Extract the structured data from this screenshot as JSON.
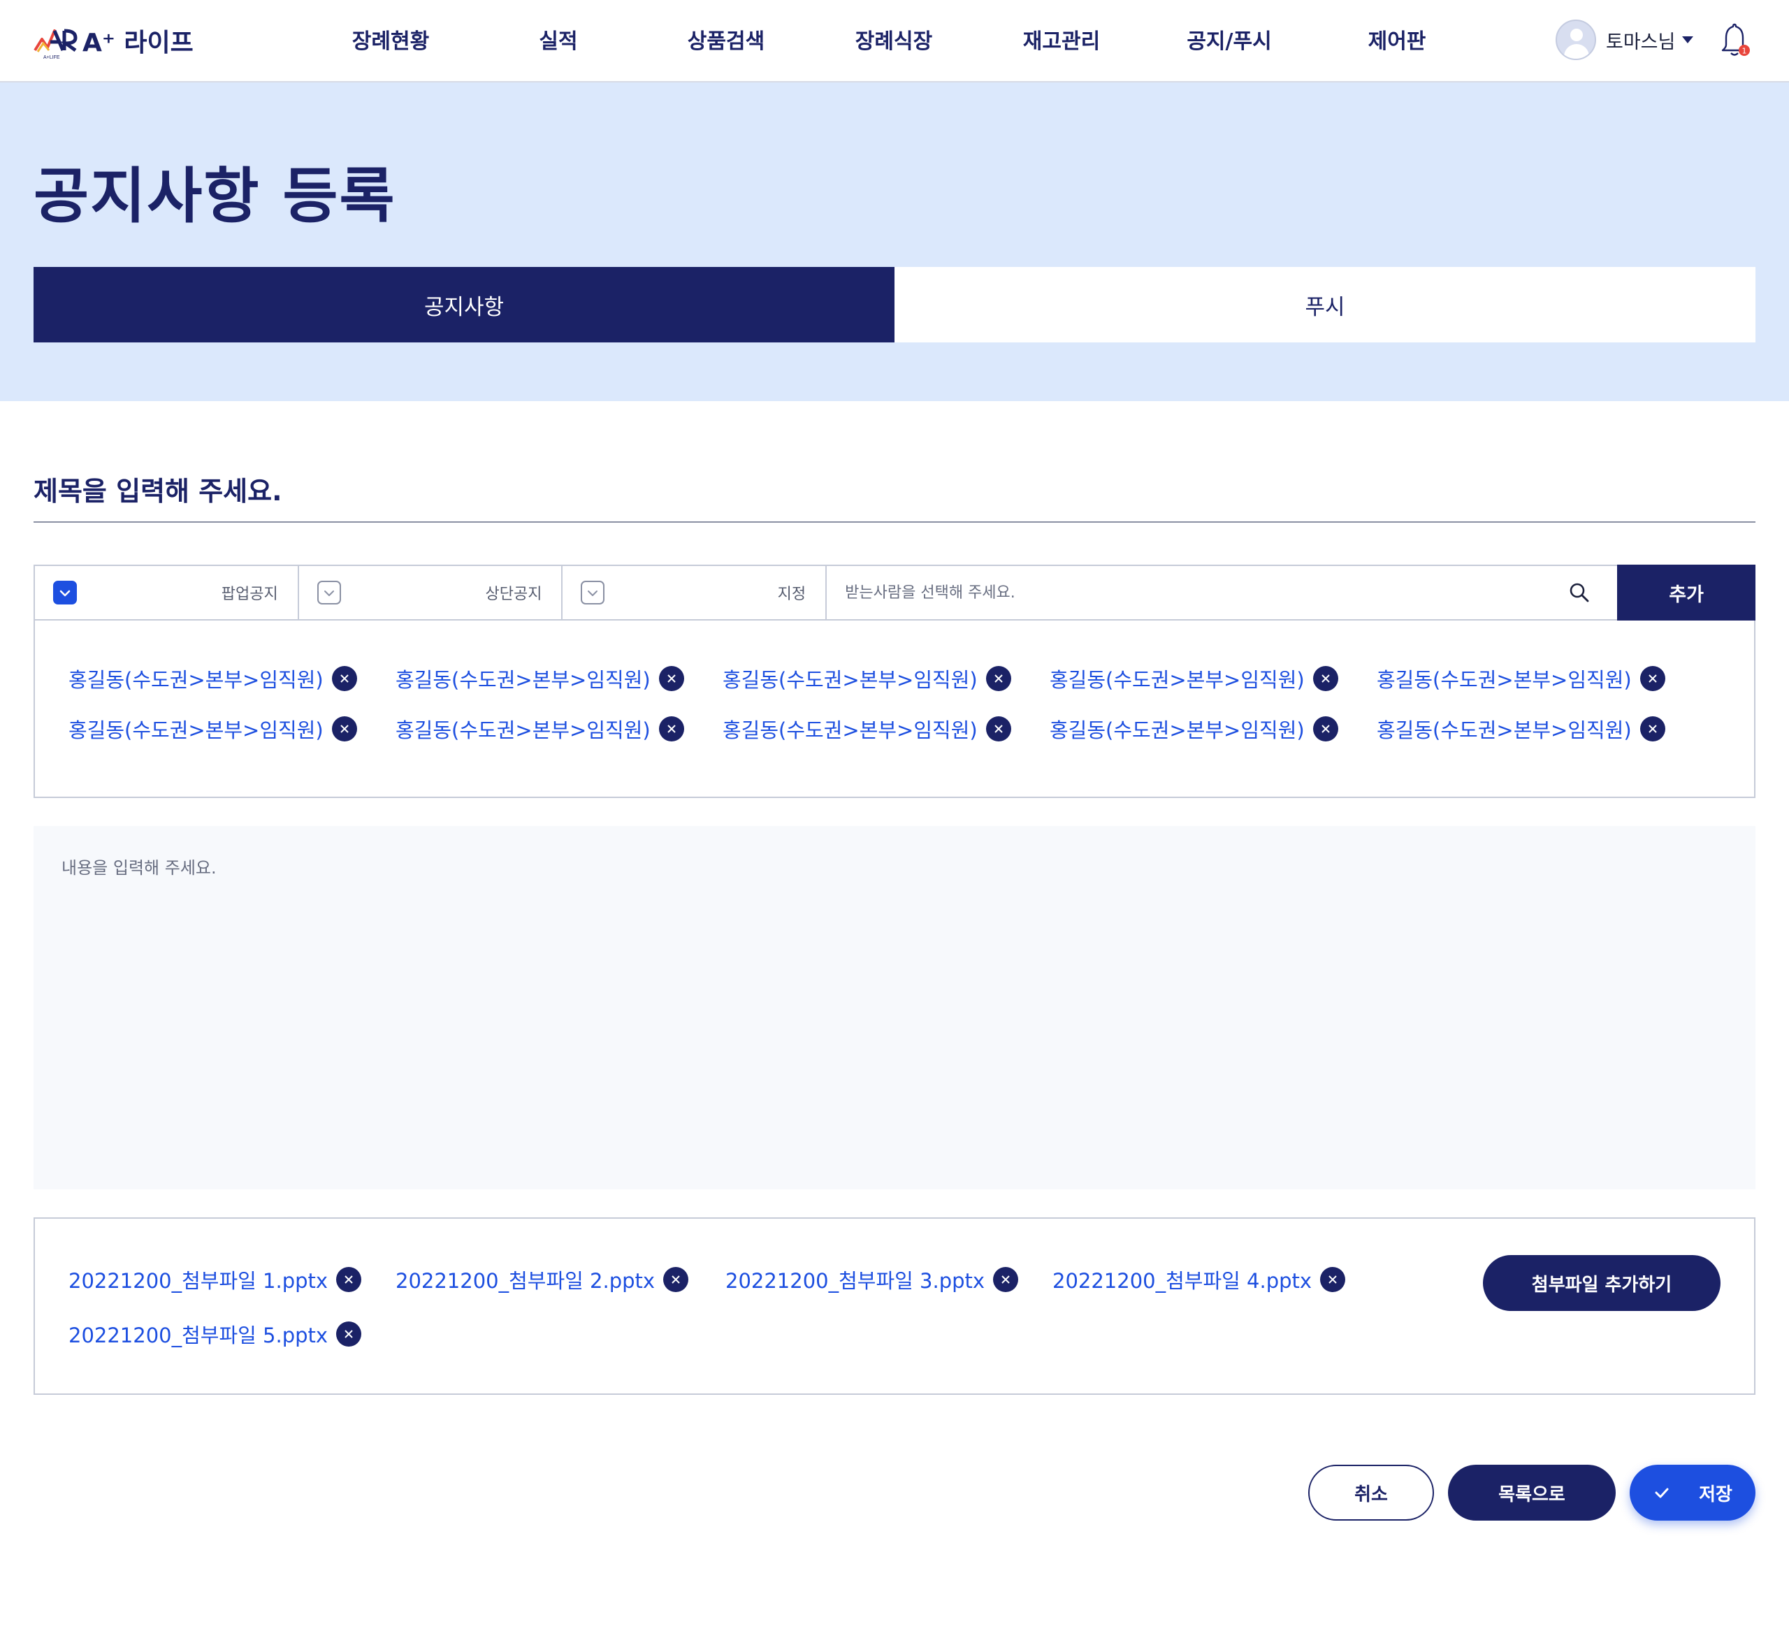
{
  "header": {
    "brand": "A⁺ 라이프",
    "nav": [
      "장례현황",
      "실적",
      "상품검색",
      "장례식장",
      "재고관리",
      "공지/푸시",
      "제어판"
    ],
    "user_name": "토마스님",
    "notification_count": 1
  },
  "page": {
    "title": "공지사항 등록",
    "tabs": [
      {
        "label": "공지사항",
        "active": true
      },
      {
        "label": "푸시",
        "active": false
      }
    ]
  },
  "form": {
    "title_placeholder": "제목을 입력해 주세요.",
    "options": [
      {
        "label": "팝업공지",
        "checked": true
      },
      {
        "label": "상단공지",
        "checked": false
      },
      {
        "label": "지정",
        "checked": false
      }
    ],
    "recipient_placeholder": "받는사람을 선택해 주세요.",
    "add_label": "추가",
    "recipients": [
      "홍길동(수도권>본부>임직원)",
      "홍길동(수도권>본부>임직원)",
      "홍길동(수도권>본부>임직원)",
      "홍길동(수도권>본부>임직원)",
      "홍길동(수도권>본부>임직원)",
      "홍길동(수도권>본부>임직원)",
      "홍길동(수도권>본부>임직원)",
      "홍길동(수도권>본부>임직원)",
      "홍길동(수도권>본부>임직원)",
      "홍길동(수도권>본부>임직원)"
    ],
    "content_placeholder": "내용을 입력해 주세요.",
    "attachments": [
      "20221200_첨부파일 1.pptx",
      "20221200_첨부파일 2.pptx",
      "20221200_첨부파일 3.pptx",
      "20221200_첨부파일 4.pptx",
      "20221200_첨부파일 5.pptx"
    ],
    "add_attachment_label": "첨부파일 추가하기"
  },
  "actions": {
    "cancel": "취소",
    "list": "목록으로",
    "save": "저장"
  },
  "colors": {
    "navy": "#1b2266",
    "accent_blue": "#1d4fe0",
    "hero_bg": "#dbe8fc",
    "notification_badge": "#e8453c"
  },
  "icons": {
    "search": "search-icon",
    "remove": "close-circle-icon",
    "bell": "bell-icon",
    "dropdown": "caret-down-icon",
    "check": "check-icon"
  }
}
